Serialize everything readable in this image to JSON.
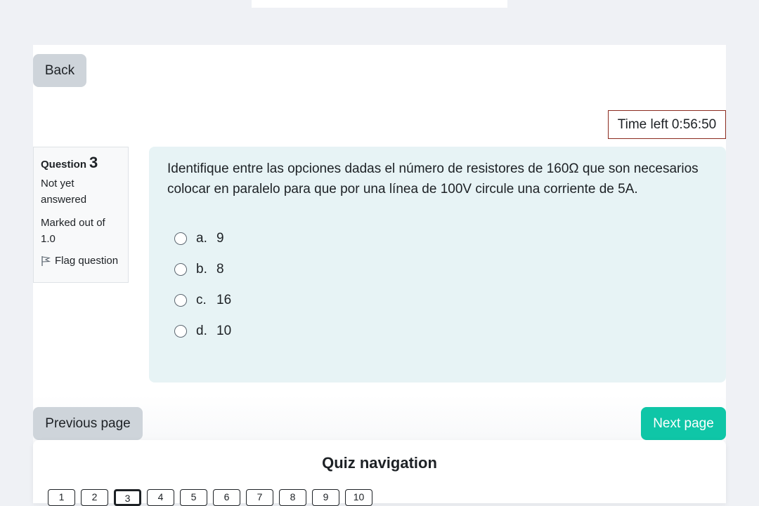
{
  "nav": {
    "back_label": "Back"
  },
  "timer": {
    "label": "Time left",
    "value": "0:56:50"
  },
  "question_info": {
    "label": "Question",
    "number": "3",
    "state": "Not yet answered",
    "grade": "Marked out of 1.0",
    "flag_label": "Flag question"
  },
  "question": {
    "text": "Identifique entre las opciones dadas el número de resistores de 160Ω que son necesarios colocar en paralelo para que por una línea de 100V circule una corriente de 5A.",
    "answers": [
      {
        "letter": "a.",
        "value": "9"
      },
      {
        "letter": "b.",
        "value": "8"
      },
      {
        "letter": "c.",
        "value": "16"
      },
      {
        "letter": "d.",
        "value": "10"
      }
    ]
  },
  "pager": {
    "prev_label": "Previous page",
    "next_label": "Next page"
  },
  "quiz_navigation": {
    "title": "Quiz navigation",
    "buttons": [
      "1",
      "2",
      "3",
      "4",
      "5",
      "6",
      "7",
      "8",
      "9",
      "10"
    ],
    "current": "3"
  },
  "colors": {
    "accent": "#0fc6a7",
    "timer_border": "#8b2a1f",
    "question_bg": "#e7f3f5"
  }
}
